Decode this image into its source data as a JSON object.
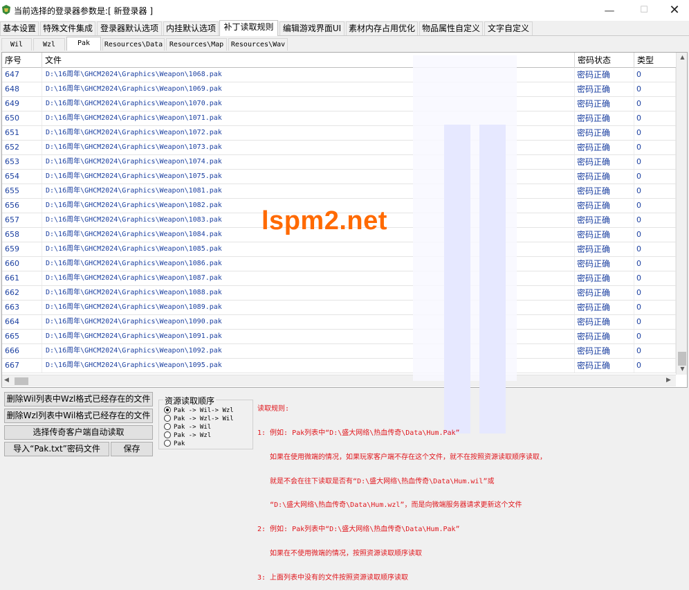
{
  "window": {
    "title": "当前选择的登录器参数是:[ 新登录器 ]",
    "min_glyph": "—",
    "max_glyph": "☐",
    "close_glyph": "✕",
    "icon": "app-icon"
  },
  "main_tabs": [
    {
      "label": "基本设置"
    },
    {
      "label": "特殊文件集成"
    },
    {
      "label": "登录器默认选项"
    },
    {
      "label": "内挂默认选项"
    },
    {
      "label": "补丁读取规则"
    },
    {
      "label": "编辑游戏界面UI"
    },
    {
      "label": "素材内存占用优化"
    },
    {
      "label": "物品属性自定义"
    },
    {
      "label": "文字自定义"
    }
  ],
  "active_main_tab": "补丁读取规则",
  "sub_tabs": [
    {
      "label": "Wil"
    },
    {
      "label": "Wzl"
    },
    {
      "label": "Pak"
    },
    {
      "label": "Resources\\Data"
    },
    {
      "label": "Resources\\Map"
    },
    {
      "label": "Resources\\Wav"
    }
  ],
  "active_sub_tab": "Pak",
  "table": {
    "headers": {
      "index": "序号",
      "file": "文件",
      "password_status": "密码状态",
      "type": "类型"
    },
    "rows": [
      {
        "index": "647",
        "file": "D:\\16周年\\GHCM2024\\Graphics\\Weapon\\1068.pak",
        "status": "密码正确",
        "type": "0"
      },
      {
        "index": "648",
        "file": "D:\\16周年\\GHCM2024\\Graphics\\Weapon\\1069.pak",
        "status": "密码正确",
        "type": "0"
      },
      {
        "index": "649",
        "file": "D:\\16周年\\GHCM2024\\Graphics\\Weapon\\1070.pak",
        "status": "密码正确",
        "type": "0"
      },
      {
        "index": "650",
        "file": "D:\\16周年\\GHCM2024\\Graphics\\Weapon\\1071.pak",
        "status": "密码正确",
        "type": "0"
      },
      {
        "index": "651",
        "file": "D:\\16周年\\GHCM2024\\Graphics\\Weapon\\1072.pak",
        "status": "密码正确",
        "type": "0"
      },
      {
        "index": "652",
        "file": "D:\\16周年\\GHCM2024\\Graphics\\Weapon\\1073.pak",
        "status": "密码正确",
        "type": "0"
      },
      {
        "index": "653",
        "file": "D:\\16周年\\GHCM2024\\Graphics\\Weapon\\1074.pak",
        "status": "密码正确",
        "type": "0"
      },
      {
        "index": "654",
        "file": "D:\\16周年\\GHCM2024\\Graphics\\Weapon\\1075.pak",
        "status": "密码正确",
        "type": "0"
      },
      {
        "index": "655",
        "file": "D:\\16周年\\GHCM2024\\Graphics\\Weapon\\1081.pak",
        "status": "密码正确",
        "type": "0"
      },
      {
        "index": "656",
        "file": "D:\\16周年\\GHCM2024\\Graphics\\Weapon\\1082.pak",
        "status": "密码正确",
        "type": "0"
      },
      {
        "index": "657",
        "file": "D:\\16周年\\GHCM2024\\Graphics\\Weapon\\1083.pak",
        "status": "密码正确",
        "type": "0"
      },
      {
        "index": "658",
        "file": "D:\\16周年\\GHCM2024\\Graphics\\Weapon\\1084.pak",
        "status": "密码正确",
        "type": "0"
      },
      {
        "index": "659",
        "file": "D:\\16周年\\GHCM2024\\Graphics\\Weapon\\1085.pak",
        "status": "密码正确",
        "type": "0"
      },
      {
        "index": "660",
        "file": "D:\\16周年\\GHCM2024\\Graphics\\Weapon\\1086.pak",
        "status": "密码正确",
        "type": "0"
      },
      {
        "index": "661",
        "file": "D:\\16周年\\GHCM2024\\Graphics\\Weapon\\1087.pak",
        "status": "密码正确",
        "type": "0"
      },
      {
        "index": "662",
        "file": "D:\\16周年\\GHCM2024\\Graphics\\Weapon\\1088.pak",
        "status": "密码正确",
        "type": "0"
      },
      {
        "index": "663",
        "file": "D:\\16周年\\GHCM2024\\Graphics\\Weapon\\1089.pak",
        "status": "密码正确",
        "type": "0"
      },
      {
        "index": "664",
        "file": "D:\\16周年\\GHCM2024\\Graphics\\Weapon\\1090.pak",
        "status": "密码正确",
        "type": "0"
      },
      {
        "index": "665",
        "file": "D:\\16周年\\GHCM2024\\Graphics\\Weapon\\1091.pak",
        "status": "密码正确",
        "type": "0"
      },
      {
        "index": "666",
        "file": "D:\\16周年\\GHCM2024\\Graphics\\Weapon\\1092.pak",
        "status": "密码正确",
        "type": "0"
      },
      {
        "index": "667",
        "file": "D:\\16周年\\GHCM2024\\Graphics\\Weapon\\1095.pak",
        "status": "密码正确",
        "type": "0"
      }
    ]
  },
  "watermark": "lspm2.net",
  "buttons": {
    "delete_wil": "删除Wil列表中Wzl格式已经存在的文件",
    "delete_wzl": "删除Wzl列表中Wil格式已经存在的文件",
    "select_client": "选择传奇客户端自动读取",
    "import_pak": "导入“Pak.txt”密码文件",
    "save": "保存"
  },
  "read_order": {
    "title": "资源读取顺序",
    "options": [
      {
        "label": "Pak -> Wil-> Wzl",
        "checked": true
      },
      {
        "label": "Pak -> Wzl-> Wil",
        "checked": false
      },
      {
        "label": "Pak -> Wil",
        "checked": false
      },
      {
        "label": "Pak -> Wzl",
        "checked": false
      },
      {
        "label": "Pak",
        "checked": false
      }
    ]
  },
  "rules": {
    "title": "读取规则:",
    "lines": [
      "1: 例如: Pak列表中“D:\\盛大网络\\热血传奇\\Data\\Hum.Pak”",
      "   如果在使用微端的情况，如果玩家客户端不存在这个文件，就不在按照资源读取顺序读取，",
      "   就是不会在往下读取是否有“D:\\盛大网络\\热血传奇\\Data\\Hum.wil”或",
      "   “D:\\盛大网络\\热血传奇\\Data\\Hum.wzl”，而是向微端服务器请求更新这个文件",
      "2: 例如: Pak列表中“D:\\盛大网络\\热血传奇\\Data\\Hum.Pak”",
      "   如果在不使用微端的情况，按照资源读取顺序读取",
      "3: 上面列表中没有的文件按照资源读取顺序读取"
    ]
  },
  "scroll": {
    "left": "◀",
    "right": "▶",
    "up": "▲",
    "down": "▼"
  }
}
